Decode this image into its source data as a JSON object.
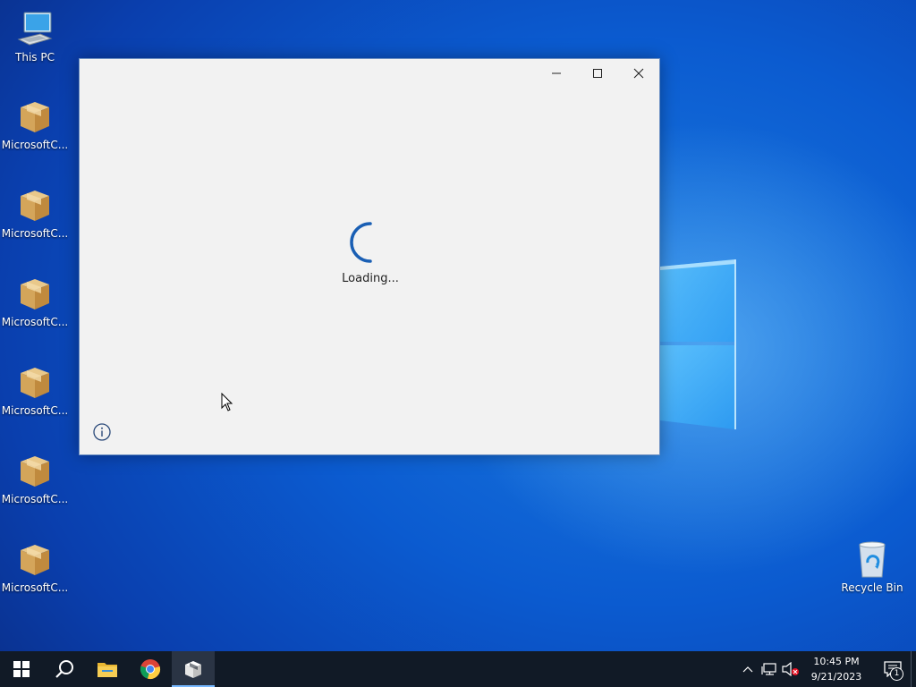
{
  "desktop": {
    "icons": [
      {
        "label": "This PC",
        "icon": "computer-icon"
      },
      {
        "label": "MicrosoftC...",
        "icon": "package-box-icon"
      },
      {
        "label": "MicrosoftC...",
        "icon": "package-box-icon"
      },
      {
        "label": "MicrosoftC...",
        "icon": "package-box-icon"
      },
      {
        "label": "MicrosoftC...",
        "icon": "package-box-icon"
      },
      {
        "label": "MicrosoftC...",
        "icon": "package-box-icon"
      },
      {
        "label": "MicrosoftC...",
        "icon": "package-box-icon"
      }
    ],
    "recycle_bin": {
      "label": "Recycle Bin",
      "icon": "recycle-bin-icon"
    }
  },
  "window": {
    "status_text": "Loading...",
    "buttons": [
      "minimize",
      "maximize",
      "close"
    ],
    "spinner_color": "#1a5fb4"
  },
  "taskbar": {
    "pinned": [
      {
        "name": "start",
        "icon": "windows-start-icon"
      },
      {
        "name": "search",
        "icon": "search-icon"
      },
      {
        "name": "file-explorer",
        "icon": "folder-icon"
      },
      {
        "name": "chrome",
        "icon": "chrome-icon"
      },
      {
        "name": "app-installer",
        "icon": "package-box-icon",
        "active": true
      }
    ],
    "clock": {
      "time": "10:45 PM",
      "date": "9/21/2023"
    },
    "notification_count": "1"
  },
  "colors": {
    "accent": "#0078d7",
    "taskbar_bg": "#111a26",
    "window_bg": "#f2f2f2"
  }
}
